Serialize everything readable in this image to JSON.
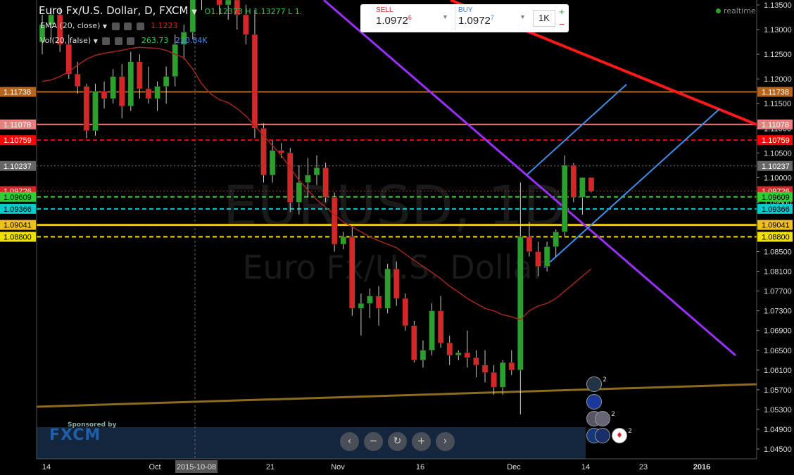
{
  "header": {
    "symbol": "Euro Fx/U.S. Dollar, D, FXCM",
    "ohlc": "O1.12373 H 1.13277 L 1."
  },
  "indicators": {
    "ema_label": "EMA (20, close)",
    "ema_value": "1.1223",
    "vol_label": "Vol(20, false)",
    "vol_value_1": "263.73",
    "vol_value_2": "220.84K"
  },
  "trade": {
    "sell_label": "SELL",
    "sell_price": "1.0972",
    "sell_sup": "6",
    "buy_label": "BUY",
    "buy_price": "1.0972",
    "buy_sup": "7",
    "qty": "1K"
  },
  "realtime": "realtime",
  "watermark": {
    "line1": "EURUSD, 1D",
    "line2": "Euro Fx/U.S. Dollar"
  },
  "sponsor": {
    "text": "Sponsored by",
    "logo": "FXCM"
  },
  "nav_buttons": [
    "‹",
    "−",
    "↻",
    "+",
    "›"
  ],
  "colors": {
    "up": "#2ca02c",
    "down": "#d62728",
    "ema": "#a0281e"
  },
  "axis": {
    "y_ticks": [
      "1.13500",
      "1.13000",
      "1.12500",
      "1.12000",
      "1.11500",
      "1.11000",
      "1.10500",
      "1.10000",
      "1.09500",
      "1.08500",
      "1.08100",
      "1.07700",
      "1.07300",
      "1.06900",
      "1.06500",
      "1.06100",
      "1.05700",
      "1.05300",
      "1.04900",
      "1.04500"
    ],
    "x_ticks": [
      "14",
      "Oct",
      "2015-10-08",
      "21",
      "Nov",
      "16",
      "Dec",
      "14",
      "23",
      "2016"
    ],
    "price_tags": [
      {
        "label": "1.11738",
        "bg": "#b5651d"
      },
      {
        "label": "1.11078",
        "bg": "#e88080"
      },
      {
        "label": "1.10759",
        "bg": "#ff0000"
      },
      {
        "label": "1.10237",
        "bg": "#666666"
      },
      {
        "label": "1.09726",
        "bg": "#d62728"
      },
      {
        "label": "1.09609",
        "bg": "#33cc33"
      },
      {
        "label": "1.09366",
        "bg": "#00cccc"
      },
      {
        "label": "1.09041",
        "bg": "#f0c020"
      },
      {
        "label": "1.08800",
        "bg": "#f0e000"
      }
    ]
  },
  "events": [
    {
      "name": "gb-flag-icon",
      "count": "2"
    },
    {
      "name": "eu-flag-icon",
      "count": ""
    },
    {
      "name": "us-flag-icon",
      "count": ""
    },
    {
      "name": "us-flag-icon",
      "count": "2"
    },
    {
      "name": "nz-flag-icon",
      "count": ""
    },
    {
      "name": "au-flag-icon",
      "count": ""
    },
    {
      "name": "ca-flag-icon",
      "count": "2"
    }
  ],
  "chart_data": {
    "type": "candlestick",
    "ohlc": [
      [
        1.1275,
        1.133,
        1.125,
        1.131
      ],
      [
        1.131,
        1.1345,
        1.128,
        1.133
      ],
      [
        1.133,
        1.1345,
        1.1255,
        1.127
      ],
      [
        1.127,
        1.129,
        1.12,
        1.121
      ],
      [
        1.121,
        1.1235,
        1.117,
        1.1185
      ],
      [
        1.1185,
        1.119,
        1.108,
        1.1095
      ],
      [
        1.1095,
        1.119,
        1.1085,
        1.1175
      ],
      [
        1.1175,
        1.1195,
        1.114,
        1.116
      ],
      [
        1.116,
        1.122,
        1.115,
        1.1205
      ],
      [
        1.1205,
        1.123,
        1.112,
        1.1145
      ],
      [
        1.1145,
        1.1255,
        1.1135,
        1.1235
      ],
      [
        1.1235,
        1.125,
        1.116,
        1.118
      ],
      [
        1.118,
        1.1225,
        1.115,
        1.116
      ],
      [
        1.116,
        1.1195,
        1.1135,
        1.1185
      ],
      [
        1.1185,
        1.1225,
        1.115,
        1.1205
      ],
      [
        1.1205,
        1.129,
        1.1185,
        1.127
      ],
      [
        1.127,
        1.131,
        1.124,
        1.1295
      ],
      [
        1.1295,
        1.1385,
        1.128,
        1.137
      ],
      [
        1.137,
        1.142,
        1.134,
        1.14
      ],
      [
        1.14,
        1.148,
        1.138,
        1.146
      ],
      [
        1.146,
        1.1495,
        1.133,
        1.135
      ],
      [
        1.135,
        1.139,
        1.132,
        1.136
      ],
      [
        1.136,
        1.1395,
        1.13,
        1.133
      ],
      [
        1.133,
        1.135,
        1.127,
        1.129
      ],
      [
        1.129,
        1.134,
        1.108,
        1.11
      ],
      [
        1.11,
        1.111,
        1.099,
        1.1005
      ],
      [
        1.1005,
        1.1075,
        1.099,
        1.1055
      ],
      [
        1.1055,
        1.107,
        1.104,
        1.105
      ],
      [
        1.105,
        1.106,
        1.093,
        1.095
      ],
      [
        1.095,
        1.1025,
        1.0925,
        1.099
      ],
      [
        1.099,
        1.104,
        1.096,
        1.1005
      ],
      [
        1.1005,
        1.1045,
        1.0985,
        1.102
      ],
      [
        1.102,
        1.103,
        1.095,
        1.096
      ],
      [
        1.096,
        1.097,
        1.085,
        1.0865
      ],
      [
        1.0865,
        1.089,
        1.0855,
        1.088
      ],
      [
        1.088,
        1.09,
        1.072,
        1.0735
      ],
      [
        1.0735,
        1.0765,
        1.068,
        1.0745
      ],
      [
        1.0745,
        1.0775,
        1.0715,
        1.076
      ],
      [
        1.076,
        1.078,
        1.07,
        1.0735
      ],
      [
        1.0735,
        1.0825,
        1.0725,
        1.0815
      ],
      [
        1.0815,
        1.083,
        1.074,
        1.0755
      ],
      [
        1.0755,
        1.0765,
        1.069,
        1.07
      ],
      [
        1.07,
        1.071,
        1.0625,
        1.063
      ],
      [
        1.063,
        1.067,
        1.0615,
        1.065
      ],
      [
        1.065,
        1.0745,
        1.064,
        1.073
      ],
      [
        1.073,
        1.076,
        1.0655,
        1.0665
      ],
      [
        1.0665,
        1.068,
        1.062,
        1.064
      ],
      [
        1.064,
        1.065,
        1.063,
        1.0645
      ],
      [
        1.0645,
        1.069,
        1.0615,
        1.0635
      ],
      [
        1.0635,
        1.065,
        1.0595,
        1.062
      ],
      [
        1.062,
        1.065,
        1.0585,
        1.0605
      ],
      [
        1.0605,
        1.062,
        1.056,
        1.0575
      ],
      [
        1.0575,
        1.063,
        1.056,
        1.0625
      ],
      [
        1.0625,
        1.065,
        1.06,
        1.061
      ],
      [
        1.061,
        1.099,
        1.052,
        1.088
      ],
      [
        1.088,
        1.091,
        1.084,
        1.085
      ],
      [
        1.085,
        1.087,
        1.08,
        1.082
      ],
      [
        1.082,
        1.087,
        1.081,
        1.086
      ],
      [
        1.086,
        1.0895,
        1.084,
        1.089
      ],
      [
        1.089,
        1.1045,
        1.088,
        1.1025
      ],
      [
        1.1025,
        1.103,
        1.095,
        1.096
      ],
      [
        1.096,
        1.099,
        1.0925,
        1.1
      ],
      [
        1.1,
        1.0985,
        1.097,
        1.0972
      ]
    ],
    "ema": [
      1.1195,
      1.1198,
      1.1205,
      1.1215,
      1.1228,
      1.124,
      1.1248,
      1.1252,
      1.1255,
      1.1258,
      1.1262,
      1.1264,
      1.1263,
      1.1262,
      1.1258,
      1.125,
      1.1243,
      1.122,
      1.119,
      1.117,
      1.1158,
      1.1152,
      1.114,
      1.1125,
      1.1105,
      1.1085,
      1.1065,
      1.1045,
      1.102,
      1.0995,
      1.0975,
      1.0955,
      1.094,
      1.0925,
      1.091,
      1.09,
      1.089,
      1.088,
      1.0872,
      1.0865,
      1.0858,
      1.0845,
      1.0832,
      1.082,
      1.0808,
      1.0795,
      1.078,
      1.0768,
      1.0755,
      1.0745,
      1.0735,
      1.073,
      1.0722,
      1.0718,
      1.0712,
      1.073,
      1.074,
      1.0745,
      1.0755,
      1.077,
      1.0785,
      1.08,
      1.0815
    ],
    "ylim": [
      1.043,
      1.136
    ]
  }
}
